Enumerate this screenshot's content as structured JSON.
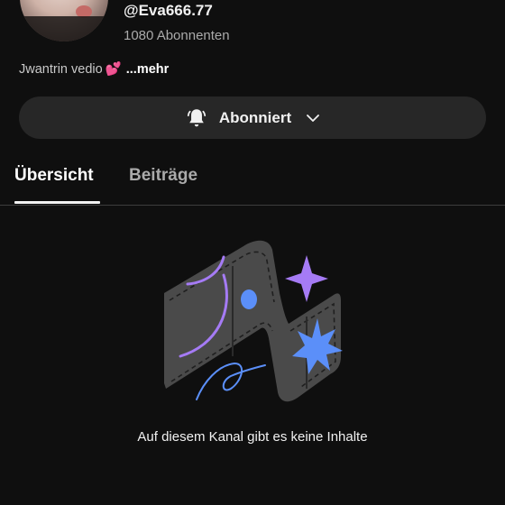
{
  "channel": {
    "handle": "@Eva666.77",
    "subscribers": "1080 Abonnenten",
    "description": "Jwantrin vedio",
    "description_emoji": "💕",
    "more_label": "...mehr"
  },
  "subscribe_button": {
    "label": "Abonniert",
    "icon": "bell-icon",
    "dropdown_icon": "chevron-down-icon"
  },
  "tabs": [
    {
      "label": "Übersicht",
      "active": true
    },
    {
      "label": "Beiträge",
      "active": false
    }
  ],
  "empty_state": {
    "message": "Auf diesem Kanal gibt es keine Inhalte"
  },
  "colors": {
    "background": "#0f0f0f",
    "button_bg": "#272727",
    "accent_purple": "#a57bf5",
    "accent_blue": "#5b8ff9"
  }
}
